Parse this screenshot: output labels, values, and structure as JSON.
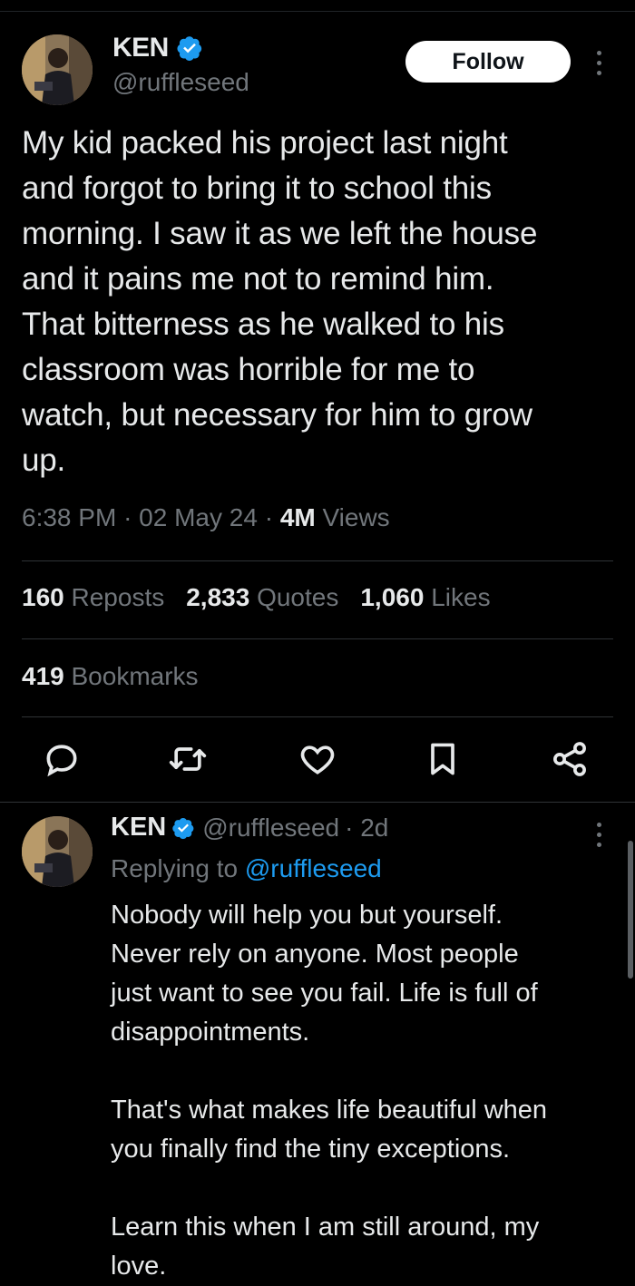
{
  "tweet": {
    "author": {
      "name": "KEN",
      "handle": "@ruffleseed",
      "verified_color": "#1d9bf0"
    },
    "follow_label": "Follow",
    "text": "My kid packed his project last night\nand forgot to bring it to school this\nmorning. I saw it as we left the house\nand it pains me not to remind him.\nThat bitterness as he walked to his\nclassroom was horrible for me to\nwatch, but necessary for him to grow\nup.",
    "time": "6:38 PM",
    "date": "02 May 24",
    "views_count": "4M",
    "views_label": "Views",
    "stats": {
      "reposts_count": "160",
      "reposts_label": "Reposts",
      "quotes_count": "2,833",
      "quotes_label": "Quotes",
      "likes_count": "1,060",
      "likes_label": "Likes",
      "bookmarks_count": "419",
      "bookmarks_label": "Bookmarks"
    },
    "action_icons": [
      "reply-icon",
      "repost-icon",
      "like-icon",
      "bookmark-icon",
      "share-icon"
    ]
  },
  "reply": {
    "author": {
      "name": "KEN",
      "handle": "@ruffleseed"
    },
    "age": "· 2d",
    "replying_prefix": "Replying to",
    "replying_handle": "@ruffleseed",
    "text": "Nobody will help you but yourself.\nNever rely on anyone. Most people\njust want to see you fail. Life is full of\ndisappointments.\n\nThat's what makes life beautiful when\nyou finally find the tiny exceptions.\n\nLearn this when I am still around, my\nlove."
  },
  "colors": {
    "background": "#000000",
    "text": "#e7e9ea",
    "secondary": "#71767b",
    "accent": "#1d9bf0",
    "divider": "#2f3336"
  }
}
